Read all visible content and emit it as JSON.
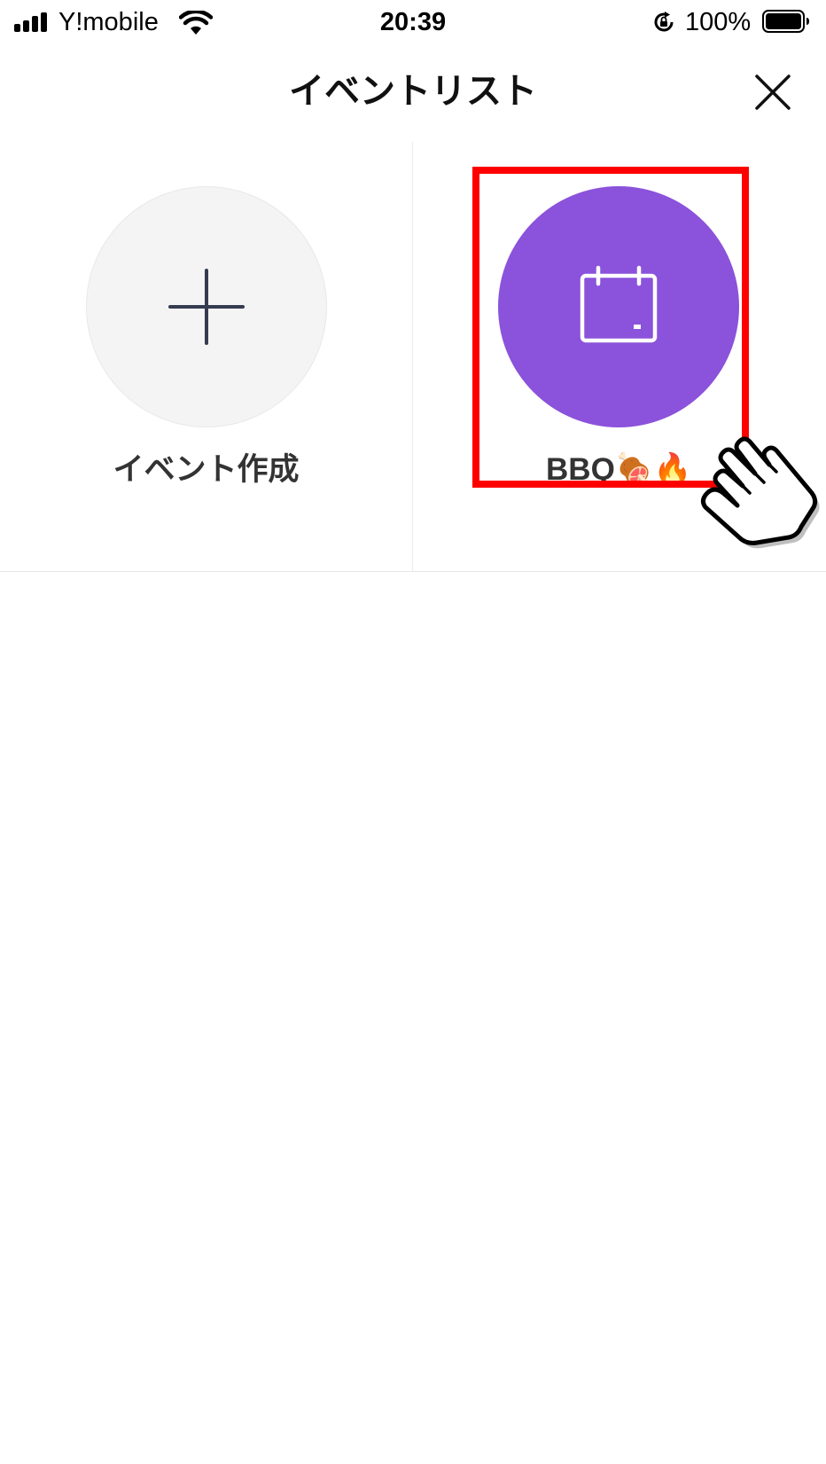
{
  "status_bar": {
    "carrier": "Y!mobile",
    "time": "20:39",
    "battery": "100%",
    "icons": [
      "signal-icon",
      "wifi-icon",
      "rotation-lock-icon",
      "battery-icon"
    ]
  },
  "header": {
    "title": "イベントリスト",
    "close_icon": "close-icon"
  },
  "events": {
    "create": {
      "label": "イベント作成",
      "icon": "plus-icon"
    },
    "items": [
      {
        "label": "BBQ🍖🔥",
        "icon": "calendar-icon",
        "color": "#8b52db"
      }
    ]
  },
  "annotation": {
    "highlight_color": "#ff0000",
    "pointer": "hand-pointer-icon"
  }
}
